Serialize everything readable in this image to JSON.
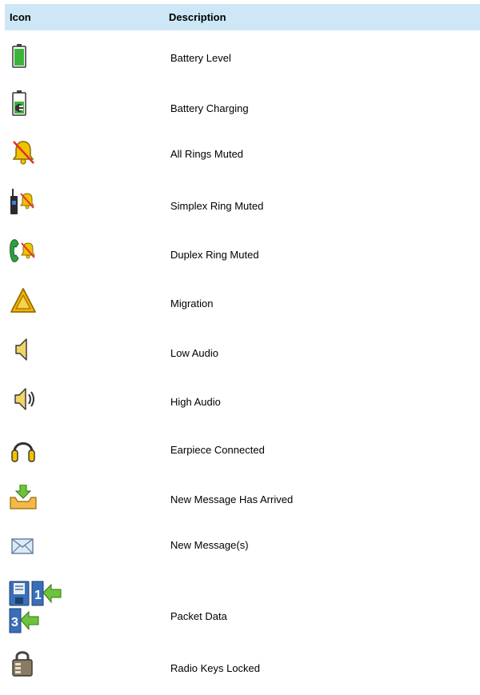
{
  "table": {
    "headers": {
      "icon": "Icon",
      "description": "Description"
    },
    "rows": [
      {
        "icon": "battery-level-icon",
        "description": "Battery Level"
      },
      {
        "icon": "battery-charging-icon",
        "description": "Battery Charging"
      },
      {
        "icon": "all-rings-muted-icon",
        "description": "All Rings Muted"
      },
      {
        "icon": "simplex-ring-muted-icon",
        "description": "Simplex Ring Muted"
      },
      {
        "icon": "duplex-ring-muted-icon",
        "description": "Duplex Ring Muted"
      },
      {
        "icon": "migration-icon",
        "description": "Migration"
      },
      {
        "icon": "low-audio-icon",
        "description": "Low Audio"
      },
      {
        "icon": "high-audio-icon",
        "description": "High Audio"
      },
      {
        "icon": "earpiece-connected-icon",
        "description": "Earpiece Connected"
      },
      {
        "icon": "new-message-arrived-icon",
        "description": "New Message Has Arrived"
      },
      {
        "icon": "new-messages-icon",
        "description": "New Message(s)"
      },
      {
        "icon": "packet-data-icon",
        "description": "Packet Data"
      },
      {
        "icon": "radio-keys-locked-icon",
        "description": "Radio Keys Locked"
      }
    ]
  },
  "colors": {
    "header_bg": "#cde7f7",
    "battery_green": "#3cb43c",
    "bell_yellow": "#e8b400",
    "mute_red": "#e03030",
    "disk_blue": "#3a6fb8"
  }
}
